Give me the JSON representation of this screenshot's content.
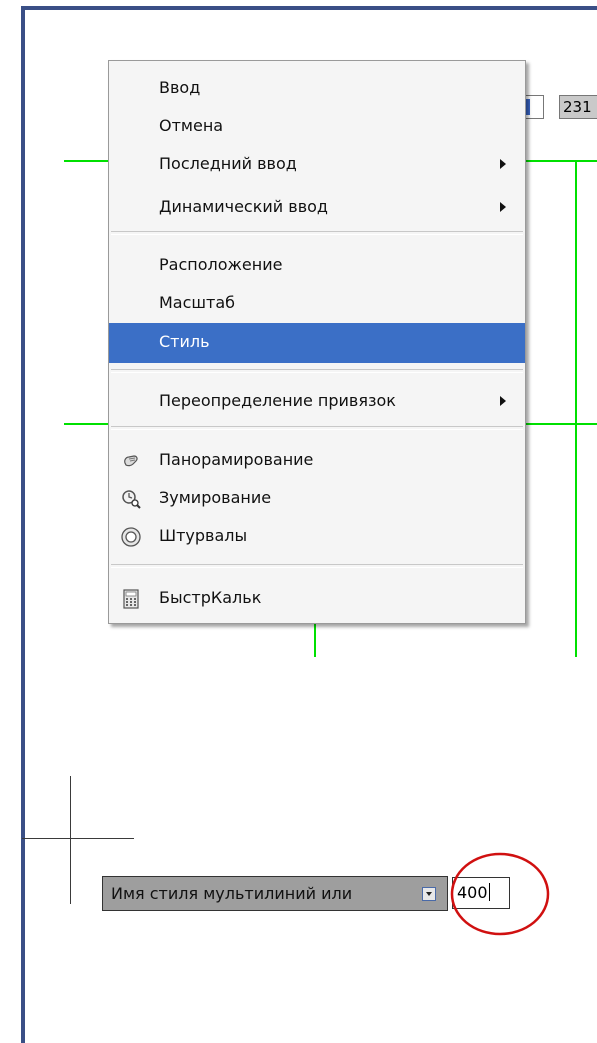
{
  "dynamic_input": {
    "y_value": "231"
  },
  "context_menu": {
    "groups": [
      [
        {
          "label": "Ввод",
          "submenu": false
        },
        {
          "label": "Отмена",
          "submenu": false
        },
        {
          "label": "Последний ввод",
          "submenu": true
        },
        {
          "label": "Динамический ввод",
          "submenu": true
        }
      ],
      [
        {
          "label": "Расположение",
          "submenu": false
        },
        {
          "label": "Масштаб",
          "submenu": false
        },
        {
          "label": "Стиль",
          "submenu": false,
          "highlighted": true
        }
      ],
      [
        {
          "label": "Переопределение привязок",
          "submenu": true
        }
      ],
      [
        {
          "label": "Панорамирование",
          "icon": "pan-hand-icon"
        },
        {
          "label": "Зумирование",
          "icon": "zoom-magnifier-icon"
        },
        {
          "label": "Штурвалы",
          "icon": "steering-wheel-icon"
        }
      ],
      [
        {
          "label": "БыстрКальк",
          "icon": "calculator-icon"
        }
      ]
    ]
  },
  "command_prompt": {
    "text": "Имя стиля мультилиний или",
    "input_value": "400"
  },
  "colors": {
    "frame_border": "#3a4f86",
    "grid_lines": "#00e000",
    "menu_highlight": "#3b6fc6",
    "annotation_circle": "#d01010"
  }
}
